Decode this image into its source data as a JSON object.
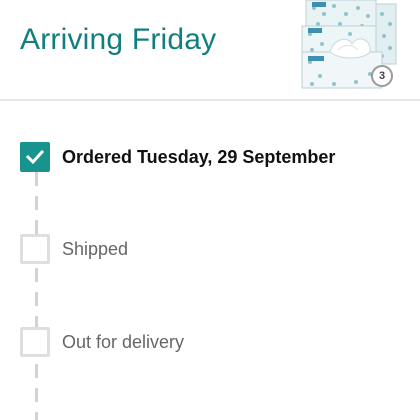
{
  "header": {
    "title": "Arriving Friday"
  },
  "product": {
    "quantity": "3",
    "image_icon": "tissue-boxes-image"
  },
  "timeline": {
    "steps": [
      {
        "label": "Ordered Tuesday, 29 September",
        "completed": true
      },
      {
        "label": "Shipped",
        "completed": false
      },
      {
        "label": "Out for delivery",
        "completed": false
      }
    ]
  },
  "colors": {
    "accent": "#137e7e",
    "checked": "#19938e",
    "inactive_text": "#666666",
    "checkbox_border": "#dedede"
  }
}
